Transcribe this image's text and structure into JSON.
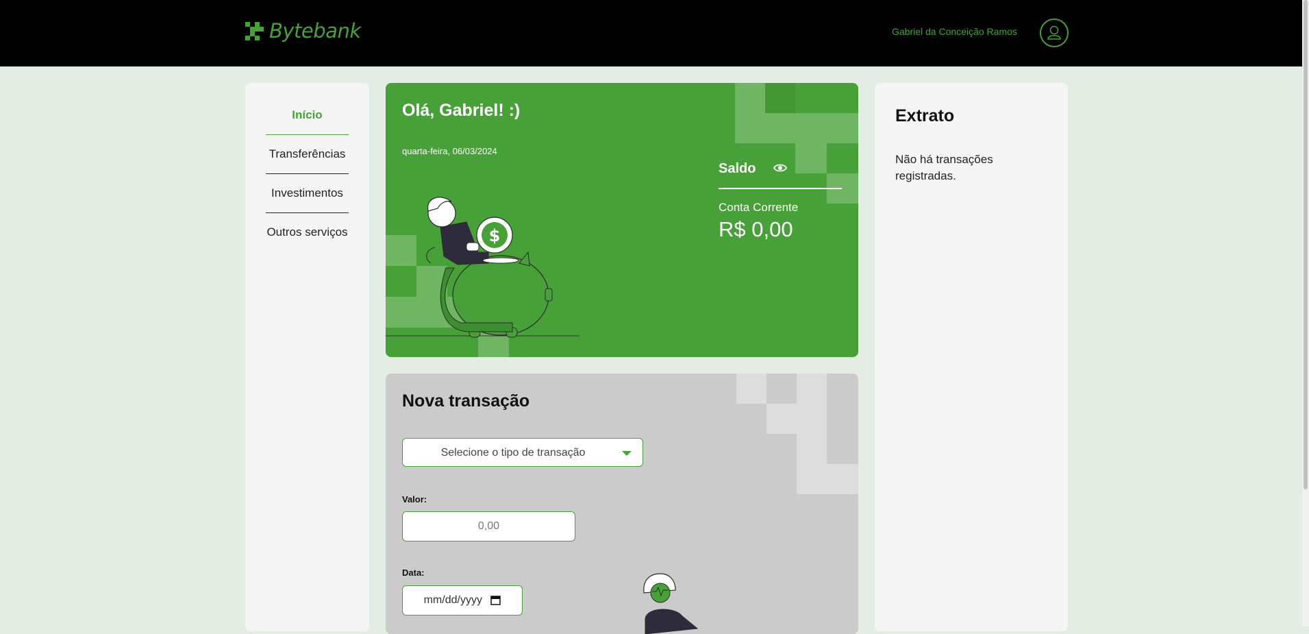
{
  "header": {
    "brand": "Bytebank",
    "user_name": "Gabriel da Conceição Ramos",
    "avatar_icon": "user-icon"
  },
  "sidebar": {
    "items": [
      {
        "label": "Início",
        "active": true
      },
      {
        "label": "Transferências",
        "active": false
      },
      {
        "label": "Investimentos",
        "active": false
      },
      {
        "label": "Outros serviços",
        "active": false
      }
    ]
  },
  "welcome": {
    "greeting": "Olá, Gabriel! :)",
    "date": "quarta-feira, 06/03/2024",
    "balance_label": "Saldo",
    "toggle_icon": "eye-icon",
    "account_type": "Conta Corrente",
    "balance": "R$ 0,00",
    "illustration": "person-with-coin-and-piggy-bank"
  },
  "transaction": {
    "title": "Nova transação",
    "type_select_placeholder": "Selecione o tipo de transação",
    "value_label": "Valor:",
    "value_placeholder": "0,00",
    "date_label": "Data:",
    "date_placeholder": "mm/dd/yyyy",
    "illustration": "person-with-card"
  },
  "statement": {
    "title": "Extrato",
    "empty_message": "Não há transações registradas."
  },
  "colors": {
    "brand_green": "#47a138",
    "header_bg": "#000000",
    "page_bg": "#e4ede3",
    "panel_bg": "#f5f5f5",
    "transaction_bg": "#cbcbcb"
  }
}
